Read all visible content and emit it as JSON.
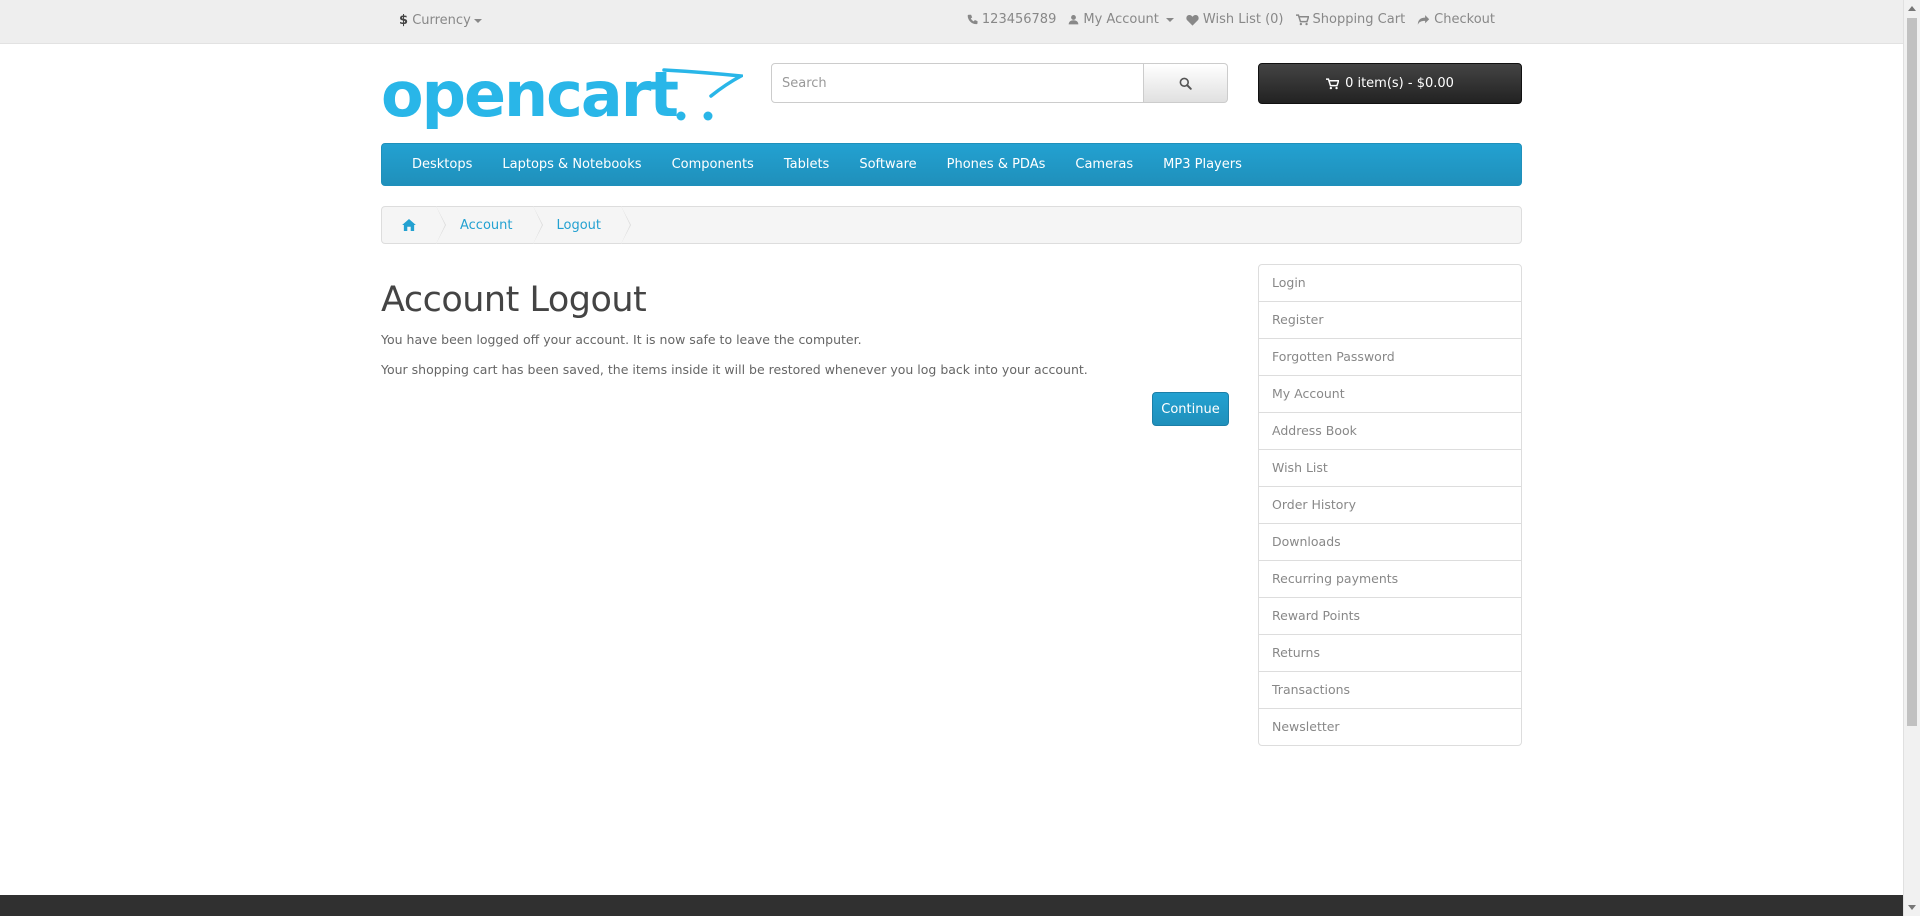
{
  "topbar": {
    "currency_symbol": "$",
    "currency_label": "Currency",
    "phone": "123456789",
    "my_account": "My Account",
    "wish_list": "Wish List (0)",
    "shopping_cart": "Shopping Cart",
    "checkout": "Checkout"
  },
  "header": {
    "logo_text": "opencart",
    "search_placeholder": "Search",
    "cart_summary": "0 item(s) - $0.00"
  },
  "menu": {
    "items": [
      "Desktops",
      "Laptops & Notebooks",
      "Components",
      "Tablets",
      "Software",
      "Phones & PDAs",
      "Cameras",
      "MP3 Players"
    ]
  },
  "breadcrumb": {
    "items": [
      "Account",
      "Logout"
    ]
  },
  "content": {
    "title": "Account Logout",
    "paragraph1": "You have been logged off your account. It is now safe to leave the computer.",
    "paragraph2": "Your shopping cart has been saved, the items inside it will be restored whenever you log back into your account.",
    "continue_label": "Continue"
  },
  "sidebar": {
    "items": [
      "Login",
      "Register",
      "Forgotten Password",
      "My Account",
      "Address Book",
      "Wish List",
      "Order History",
      "Downloads",
      "Recurring payments",
      "Reward Points",
      "Returns",
      "Transactions",
      "Newsletter"
    ]
  },
  "colors": {
    "accent": "#23a1d1",
    "logo": "#29b6e8",
    "cart_bg": "#333333",
    "footer": "#303030"
  }
}
